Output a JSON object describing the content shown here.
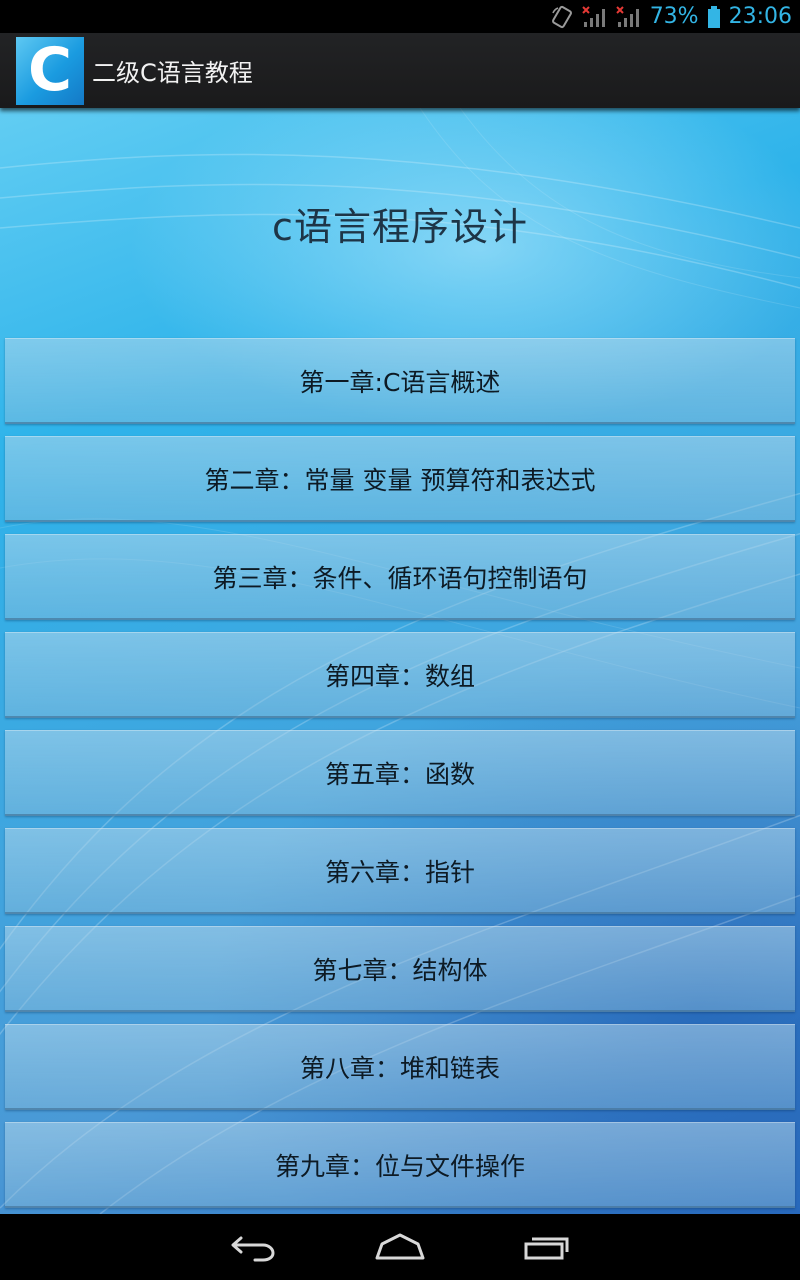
{
  "status_bar": {
    "battery_percent": "73%",
    "time": "23:06",
    "accent_color": "#33b5e5",
    "icons": [
      "rotation-lock-icon",
      "signal-no-sim-icon",
      "signal-no-sim-icon",
      "battery-icon"
    ]
  },
  "action_bar": {
    "logo_letter": "C",
    "title": "二级C语言教程"
  },
  "main": {
    "heading": "c语言程序设计",
    "chapters": [
      {
        "label": "第一章:C语言概述"
      },
      {
        "label": "第二章：常量 变量 预算符和表达式"
      },
      {
        "label": "第三章：条件、循环语句控制语句"
      },
      {
        "label": "第四章：数组"
      },
      {
        "label": "第五章：函数"
      },
      {
        "label": "第六章：指针"
      },
      {
        "label": "第七章：结构体"
      },
      {
        "label": "第八章：堆和链表"
      },
      {
        "label": "第九章：位与文件操作"
      }
    ]
  },
  "nav_bar": {
    "icons": [
      "back-icon",
      "home-icon",
      "recent-apps-icon"
    ]
  }
}
